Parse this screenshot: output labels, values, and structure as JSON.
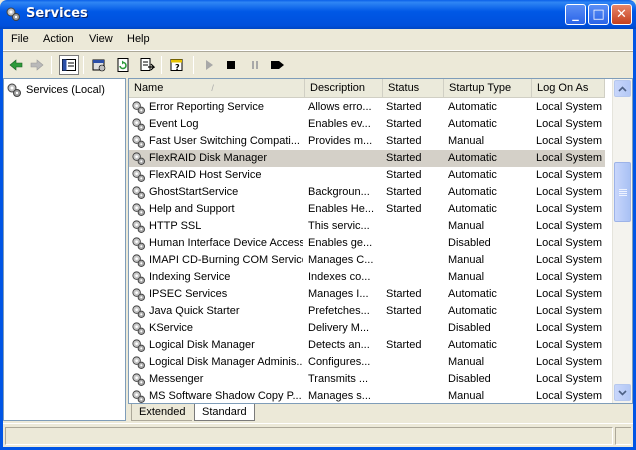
{
  "window": {
    "title": "Services",
    "icon": "gears-icon",
    "controls": [
      "minimize",
      "maximize",
      "close"
    ]
  },
  "menu": [
    "File",
    "Action",
    "View",
    "Help"
  ],
  "toolbar": {
    "buttons": [
      "back-arrow-icon",
      "forward-arrow-icon",
      "show-hide-tree-icon",
      "properties-icon",
      "refresh-icon",
      "export-list-icon",
      "help-icon",
      "start-service-icon",
      "stop-service-icon",
      "pause-service-icon",
      "restart-service-icon"
    ]
  },
  "tree": {
    "root": "Services (Local)"
  },
  "list": {
    "columns": [
      "Name",
      "Description",
      "Status",
      "Startup Type",
      "Log On As"
    ],
    "rows": [
      {
        "name": "Error Reporting Service",
        "description": "Allows erro...",
        "status": "Started",
        "startup": "Automatic",
        "logon": "Local System"
      },
      {
        "name": "Event Log",
        "description": "Enables ev...",
        "status": "Started",
        "startup": "Automatic",
        "logon": "Local System"
      },
      {
        "name": "Fast User Switching Compati...",
        "description": "Provides m...",
        "status": "Started",
        "startup": "Manual",
        "logon": "Local System"
      },
      {
        "name": "FlexRAID Disk Manager",
        "description": "",
        "status": "Started",
        "startup": "Automatic",
        "logon": "Local System",
        "selected": true
      },
      {
        "name": "FlexRAID Host Service",
        "description": "",
        "status": "Started",
        "startup": "Automatic",
        "logon": "Local System"
      },
      {
        "name": "GhostStartService",
        "description": "Backgroun...",
        "status": "Started",
        "startup": "Automatic",
        "logon": "Local System"
      },
      {
        "name": "Help and Support",
        "description": "Enables He...",
        "status": "Started",
        "startup": "Automatic",
        "logon": "Local System"
      },
      {
        "name": "HTTP SSL",
        "description": "This servic...",
        "status": "",
        "startup": "Manual",
        "logon": "Local System"
      },
      {
        "name": "Human Interface Device Access",
        "description": "Enables ge...",
        "status": "",
        "startup": "Disabled",
        "logon": "Local System"
      },
      {
        "name": "IMAPI CD-Burning COM Service",
        "description": "Manages C...",
        "status": "",
        "startup": "Manual",
        "logon": "Local System"
      },
      {
        "name": "Indexing Service",
        "description": "Indexes co...",
        "status": "",
        "startup": "Manual",
        "logon": "Local System"
      },
      {
        "name": "IPSEC Services",
        "description": "Manages I...",
        "status": "Started",
        "startup": "Automatic",
        "logon": "Local System"
      },
      {
        "name": "Java Quick Starter",
        "description": "Prefetches...",
        "status": "Started",
        "startup": "Automatic",
        "logon": "Local System"
      },
      {
        "name": "KService",
        "description": "Delivery M...",
        "status": "",
        "startup": "Disabled",
        "logon": "Local System"
      },
      {
        "name": "Logical Disk Manager",
        "description": "Detects an...",
        "status": "Started",
        "startup": "Automatic",
        "logon": "Local System"
      },
      {
        "name": "Logical Disk Manager Adminis...",
        "description": "Configures...",
        "status": "",
        "startup": "Manual",
        "logon": "Local System"
      },
      {
        "name": "Messenger",
        "description": "Transmits ...",
        "status": "",
        "startup": "Disabled",
        "logon": "Local System"
      },
      {
        "name": "MS Software Shadow Copy P...",
        "description": "Manages s...",
        "status": "",
        "startup": "Manual",
        "logon": "Local System"
      }
    ]
  },
  "tabs": [
    "Extended",
    "Standard"
  ],
  "active_tab": "Standard",
  "colors": {
    "titlebar": "#0058e6",
    "selection": "#d4d0c8",
    "window_bg": "#ece9d8"
  }
}
